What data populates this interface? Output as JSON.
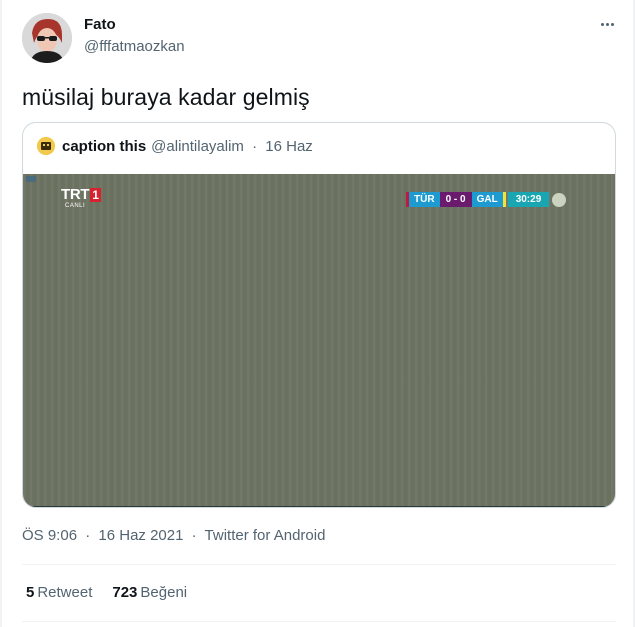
{
  "author": {
    "name": "Fato",
    "handle": "@fffatmaozkan"
  },
  "tweet": {
    "text": "müsilaj buraya kadar gelmiş"
  },
  "quoted": {
    "name": "caption this",
    "handle": "@alintilayalim",
    "sep": "·",
    "date": "16 Haz",
    "media": {
      "channel_logo": "TRT",
      "channel_logo_num": "1",
      "channel_sub": "CANLI",
      "team1": "TÜR",
      "score": "0 - 0",
      "team2": "GAL",
      "clock": "30:29"
    }
  },
  "meta": {
    "time": "ÖS 9:06",
    "sep1": "·",
    "date": "16 Haz 2021",
    "sep2": "·",
    "source": "Twitter for Android"
  },
  "stats": {
    "retweets": "5",
    "retweets_label": "Retweet",
    "likes": "723",
    "likes_label": "Beğeni"
  },
  "colors": {
    "text": "#0f1419",
    "secondary": "#536471",
    "border": "#cfd9de",
    "pitch": "#6e7462"
  }
}
